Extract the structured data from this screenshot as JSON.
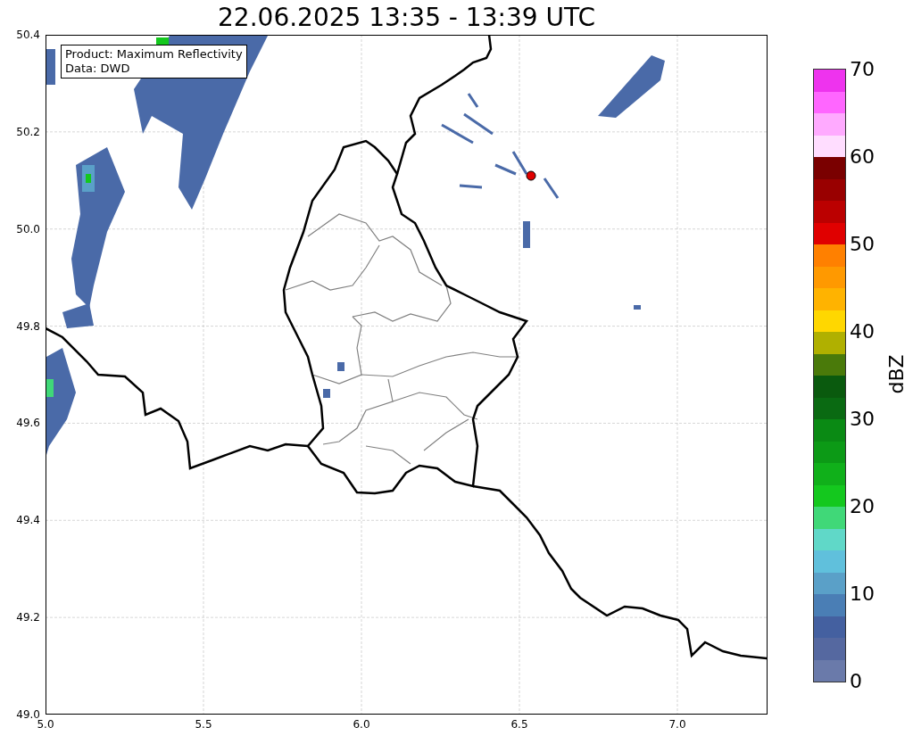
{
  "title": "22.06.2025 13:35 - 13:39 UTC",
  "map": {
    "legend_box": [
      "Product: Maximum Reflectivity",
      "Data: DWD"
    ],
    "x_ticks": [
      "5.0",
      "5.5",
      "6.0",
      "6.5",
      "7.0"
    ],
    "y_ticks": [
      "50.4",
      "50.2",
      "50.0",
      "49.8",
      "49.6",
      "49.4",
      "49.2",
      "49.0"
    ]
  },
  "colorbar": {
    "label": "dBZ",
    "ticks": [
      "70",
      "60",
      "50",
      "40",
      "30",
      "20",
      "10",
      "0"
    ],
    "segments": [
      {
        "color": "#6a7aaa"
      },
      {
        "color": "#5568a0"
      },
      {
        "color": "#4460a0"
      },
      {
        "color": "#4a7eb5"
      },
      {
        "color": "#5aa0c8"
      },
      {
        "color": "#60c0dc"
      },
      {
        "color": "#60d8c8"
      },
      {
        "color": "#40d878"
      },
      {
        "color": "#14c81e"
      },
      {
        "color": "#10b01a"
      },
      {
        "color": "#0c9a16"
      },
      {
        "color": "#0a8a14"
      },
      {
        "color": "#0a6a12"
      },
      {
        "color": "#0a5a0e"
      },
      {
        "color": "#4a7a0a"
      },
      {
        "color": "#b0b000"
      },
      {
        "color": "#ffd700"
      },
      {
        "color": "#ffb300"
      },
      {
        "color": "#ff9900"
      },
      {
        "color": "#ff8000"
      },
      {
        "color": "#e00000"
      },
      {
        "color": "#bb0000"
      },
      {
        "color": "#990000"
      },
      {
        "color": "#7a0000"
      },
      {
        "color": "#ffddff"
      },
      {
        "color": "#ffaaff"
      },
      {
        "color": "#ff66ff"
      },
      {
        "color": "#ee33ee"
      }
    ]
  }
}
